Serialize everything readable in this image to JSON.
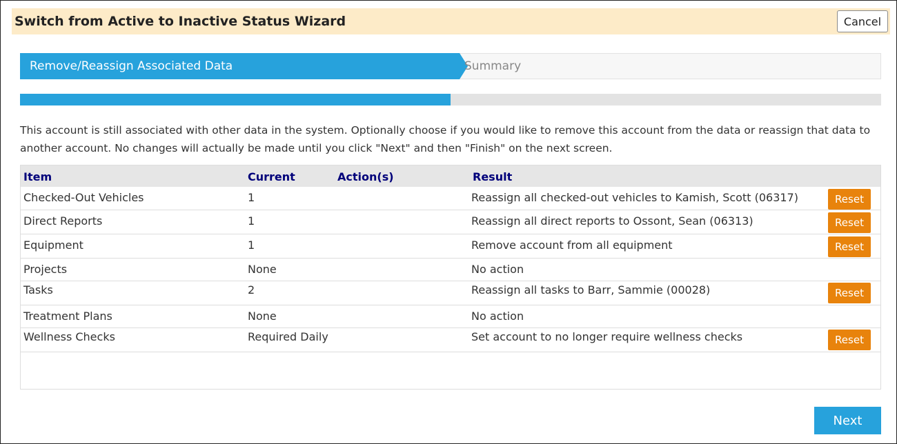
{
  "wizard": {
    "title": "Switch from Active to Inactive Status Wizard",
    "cancel_label": "Cancel"
  },
  "steps": [
    {
      "label": "Remove/Reassign Associated Data",
      "active": true
    },
    {
      "label": "Summary",
      "active": false
    }
  ],
  "progress": {
    "fraction": 0.5
  },
  "description": "This account is still associated with other data in the system. Optionally choose if you would like to remove this account from the data or reassign that data to another account. No changes will actually be made until you click \"Next\" and then \"Finish\" on the next screen.",
  "table": {
    "headers": {
      "item": "Item",
      "current": "Current",
      "actions": "Action(s)",
      "result": "Result"
    },
    "reset_label": "Reset",
    "rows": [
      {
        "item": "Checked-Out Vehicles",
        "current": "1",
        "result": "Reassign all checked-out vehicles to Kamish, Scott (06317)",
        "has_reset": true
      },
      {
        "item": "Direct Reports",
        "current": "1",
        "result": "Reassign all direct reports to Ossont, Sean (06313)",
        "has_reset": true
      },
      {
        "item": "Equipment",
        "current": "1",
        "result": "Remove account from all equipment",
        "has_reset": true
      },
      {
        "item": "Projects",
        "current": "None",
        "result": "No action",
        "has_reset": false
      },
      {
        "item": "Tasks",
        "current": "2",
        "result": "Reassign all tasks to Barr, Sammie (00028)",
        "has_reset": true
      },
      {
        "item": "Treatment Plans",
        "current": "None",
        "result": "No action",
        "has_reset": false
      },
      {
        "item": "Wellness Checks",
        "current": "Required Daily",
        "result": "Set account to no longer require wellness checks",
        "has_reset": true
      }
    ]
  },
  "next_label": "Next",
  "colors": {
    "header_bg": "#fdebc8",
    "accent_blue": "#27a2dc",
    "reset_orange": "#e8830c",
    "header_text": "#00007a"
  }
}
